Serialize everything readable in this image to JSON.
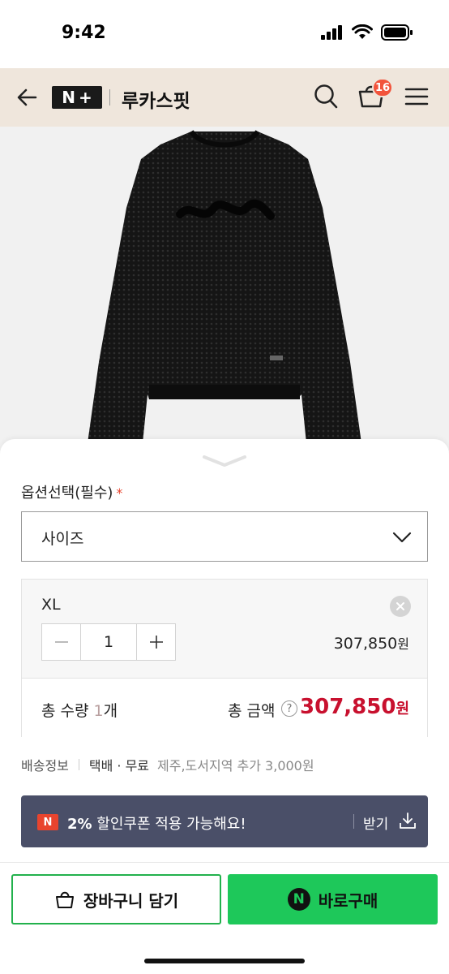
{
  "status_bar": {
    "time": "9:42"
  },
  "header": {
    "logo_letter": "N",
    "logo_plus": "+",
    "store_name": "루카스핏",
    "cart_count": "16"
  },
  "options": {
    "label": "옵션선택(필수)",
    "required_mark": "*",
    "select_label": "사이즈"
  },
  "selected_item": {
    "name": "XL",
    "quantity": "1",
    "price": "307,850",
    "price_unit": "원"
  },
  "total": {
    "qty_prefix": "총 수량 ",
    "qty_value": "1",
    "qty_suffix": "개",
    "amount_label": "총 금액",
    "help_glyph": "?",
    "amount": "307,850",
    "amount_unit": "원"
  },
  "shipping": {
    "label": "배송정보",
    "method": "택배 · 무료",
    "extra": "제주,도서지역 추가 3,000원"
  },
  "coupon": {
    "badge": "N",
    "percent": "2%",
    "text": " 할인쿠폰 적용 가능해요!",
    "get_label": "받기"
  },
  "actions": {
    "cart_label": "장바구니 담기",
    "buy_icon_letter": "N",
    "buy_label": "바로구매"
  },
  "colors": {
    "header_bg": "#efe6dc",
    "badge": "#f2543c",
    "price_red": "#c8102e",
    "coupon_bg": "#4a4f68",
    "buy_green": "#1ec85a"
  }
}
